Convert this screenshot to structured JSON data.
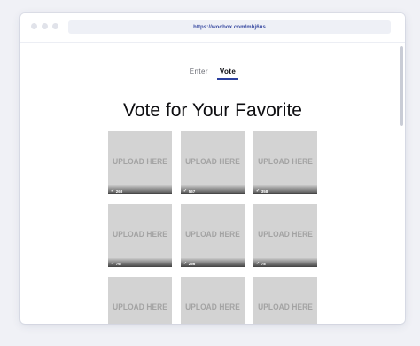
{
  "browser": {
    "url": "https://woobox.com/mhj6us"
  },
  "tabs": [
    {
      "label": "Enter"
    },
    {
      "label": "Vote"
    }
  ],
  "page": {
    "heading": "Vote for Your Favorite"
  },
  "entries": [
    {
      "label": "UPLOAD HERE",
      "votes": "268"
    },
    {
      "label": "UPLOAD HERE",
      "votes": "567"
    },
    {
      "label": "UPLOAD HERE",
      "votes": "358"
    },
    {
      "label": "UPLOAD HERE",
      "votes": "76"
    },
    {
      "label": "UPLOAD HERE",
      "votes": "256"
    },
    {
      "label": "UPLOAD HERE",
      "votes": "78"
    },
    {
      "label": "UPLOAD HERE",
      "votes": ""
    },
    {
      "label": "UPLOAD HERE",
      "votes": ""
    },
    {
      "label": "UPLOAD HERE",
      "votes": ""
    }
  ],
  "icons": {
    "vote": "check-icon"
  }
}
